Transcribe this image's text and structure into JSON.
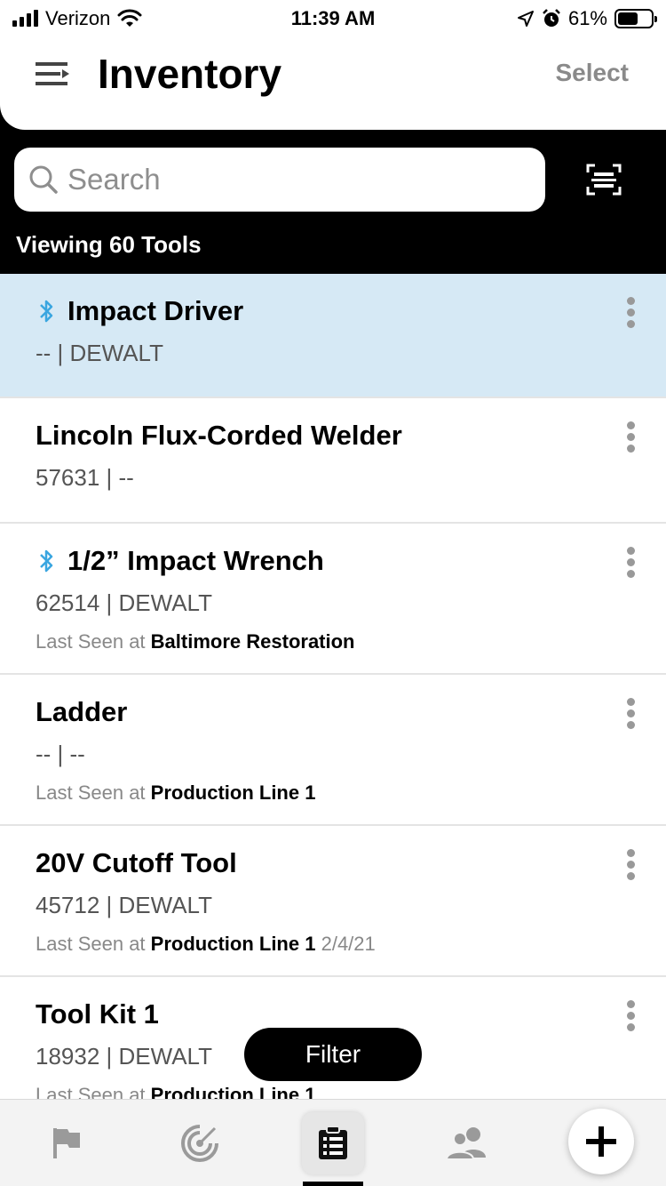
{
  "status": {
    "carrier": "Verizon",
    "time": "11:39 AM",
    "battery": "61%",
    "battery_level": 0.61
  },
  "header": {
    "title": "Inventory",
    "select_label": "Select"
  },
  "search": {
    "placeholder": "Search"
  },
  "viewing_text": "Viewing 60 Tools",
  "tools": [
    {
      "name": "Impact Driver",
      "sub": "-- | DEWALT",
      "bluetooth": true,
      "selected": true
    },
    {
      "name": "Lincoln Flux-Corded Welder",
      "sub": "57631 | --",
      "bluetooth": false
    },
    {
      "name": "1/2” Impact Wrench",
      "sub": "62514 | DEWALT",
      "bluetooth": true,
      "seen_prefix": "Last Seen at",
      "seen_location": "Baltimore Restoration"
    },
    {
      "name": "Ladder",
      "sub": "-- | --",
      "bluetooth": false,
      "seen_prefix": "Last Seen at",
      "seen_location": "Production Line 1"
    },
    {
      "name": "20V Cutoff Tool",
      "sub": "45712 | DEWALT",
      "bluetooth": false,
      "seen_prefix": "Last Seen at",
      "seen_location": "Production Line 1",
      "seen_date": "2/4/21"
    },
    {
      "name": "Tool Kit 1",
      "sub": "18932 | DEWALT",
      "bluetooth": false,
      "seen_prefix": "Last Seen at",
      "seen_location": "Production Line 1"
    }
  ],
  "filter_label": "Filter",
  "tabs": [
    {
      "icon": "flag-icon"
    },
    {
      "icon": "radar-icon"
    },
    {
      "icon": "clipboard-list-icon",
      "active": true
    },
    {
      "icon": "users-icon"
    }
  ],
  "colors": {
    "selected_row": "#d6e9f5",
    "bluetooth": "#3aa6e0"
  }
}
